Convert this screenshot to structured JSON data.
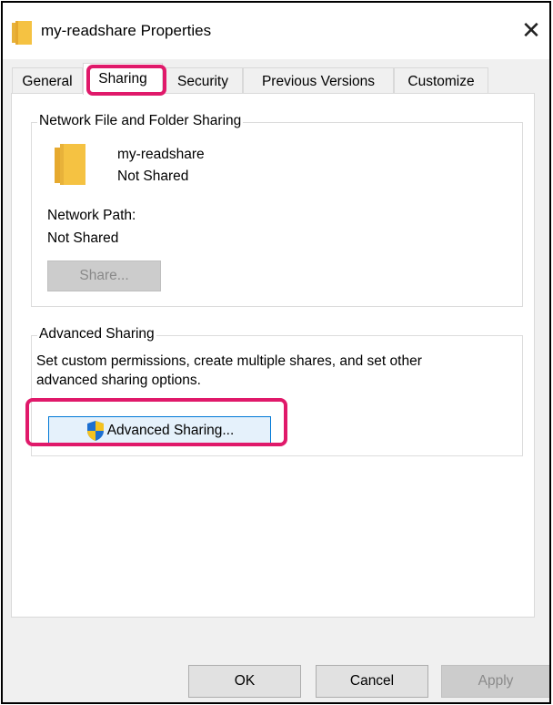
{
  "window": {
    "title": "my-readshare Properties",
    "close_glyph": "✕"
  },
  "tabs": [
    {
      "label": "General",
      "active": false
    },
    {
      "label": "Sharing",
      "active": true
    },
    {
      "label": "Security",
      "active": false
    },
    {
      "label": "Previous Versions",
      "active": false
    },
    {
      "label": "Customize",
      "active": false
    }
  ],
  "network_sharing": {
    "legend": "Network File and Folder Sharing",
    "folder_name": "my-readshare",
    "folder_status": "Not Shared",
    "path_label": "Network Path:",
    "path_value": "Not Shared",
    "share_button": "Share..."
  },
  "advanced_sharing": {
    "legend": "Advanced Sharing",
    "description_line1": "Set custom permissions, create multiple shares, and set other",
    "description_line2": "advanced sharing options.",
    "button_label": "Advanced Sharing..."
  },
  "footer": {
    "ok": "OK",
    "cancel": "Cancel",
    "apply": "Apply"
  },
  "colors": {
    "highlight": "#e0196a",
    "folder": "#f5c242",
    "focus_border": "#0078d7"
  },
  "icons": {
    "title": "folder-icon",
    "folder": "folder-icon",
    "shield": "uac-shield-icon",
    "close": "close-icon"
  }
}
